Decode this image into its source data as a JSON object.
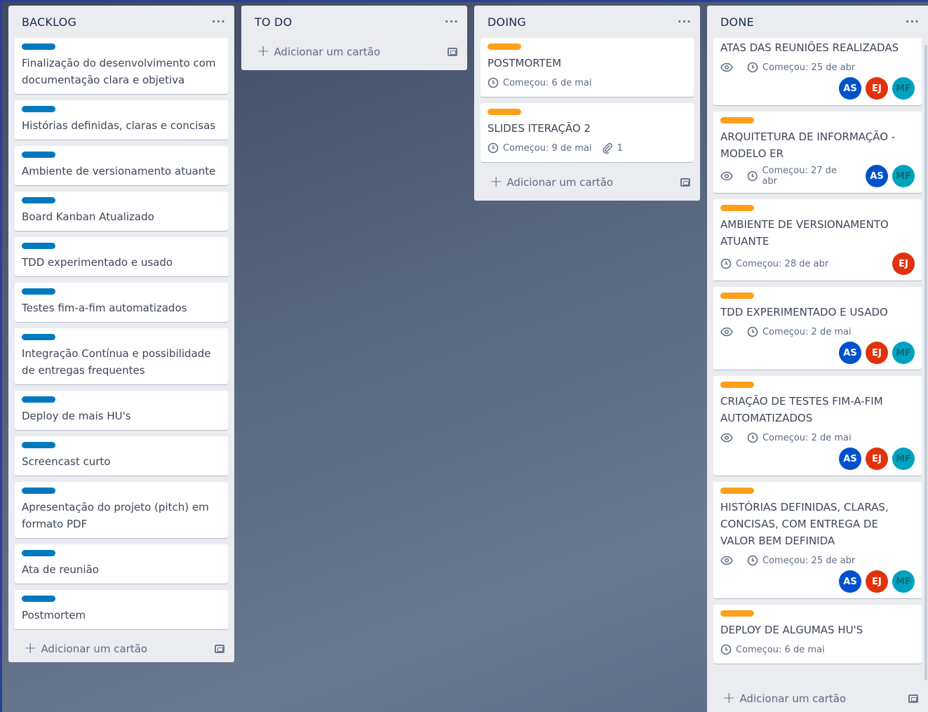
{
  "board": {
    "add_card_label": "Adicionar um cartão",
    "menu_label": "···",
    "colors": {
      "blue_label": "#0079bf",
      "orange_label": "#ff9f1a",
      "avatar_as": "#0052cc",
      "avatar_ej": "#e0320d",
      "avatar_mf": "#00a3bf"
    }
  },
  "lists": {
    "backlog": {
      "title": "BACKLOG",
      "cards": [
        {
          "title": "Finalização do desenvolvimento com documentação clara e objetiva"
        },
        {
          "title": "Histórias definidas, claras e concisas"
        },
        {
          "title": "Ambiente de versionamento atuante"
        },
        {
          "title": "Board Kanban Atualizado"
        },
        {
          "title": "TDD experimentado e usado"
        },
        {
          "title": "Testes fim-a-fim automatizados"
        },
        {
          "title": "Integração Contínua e possibilidade de entregas frequentes"
        },
        {
          "title": "Deploy de mais HU's"
        },
        {
          "title": "Screencast curto"
        },
        {
          "title": "Apresentação do projeto (pitch) em formato PDF"
        },
        {
          "title": "Ata de reunião"
        },
        {
          "title": "Postmortem"
        }
      ]
    },
    "todo": {
      "title": "TO DO"
    },
    "doing": {
      "title": "DOING",
      "cards": [
        {
          "title": "POSTMORTEM",
          "start": "Começou: 6 de mai"
        },
        {
          "title": "SLIDES ITERAÇÃO 2",
          "start": "Começou: 9 de mai",
          "attachments": "1"
        }
      ]
    },
    "done": {
      "title": "DONE",
      "cards": [
        {
          "title": "ATAS DAS REUNIÕES REALIZADAS",
          "start": "Começou: 25 de abr",
          "members": [
            "AS",
            "EJ",
            "MF"
          ]
        },
        {
          "title": "ARQUITETURA DE INFORMAÇÃO - MODELO ER",
          "start": "Começou: 27 de abr",
          "members": [
            "AS",
            "MF"
          ]
        },
        {
          "title": "AMBIENTE DE VERSIONAMENTO ATUANTE",
          "start": "Começou: 28 de abr",
          "members": [
            "EJ"
          ]
        },
        {
          "title": "TDD EXPERIMENTADO E USADO",
          "start": "Começou: 2 de mai",
          "members": [
            "AS",
            "EJ",
            "MF"
          ]
        },
        {
          "title": "CRIAÇÃO DE TESTES FIM-A-FIM AUTOMATIZADOS",
          "start": "Começou: 2 de mai",
          "members": [
            "AS",
            "EJ",
            "MF"
          ]
        },
        {
          "title": "HISTÓRIAS DEFINIDAS, CLARAS, CONCISAS, COM ENTREGA DE VALOR BEM DEFINIDA",
          "start": "Começou: 25 de abr",
          "members": [
            "AS",
            "EJ",
            "MF"
          ]
        },
        {
          "title": "DEPLOY DE ALGUMAS HU'S",
          "start": "Começou: 6 de mai"
        }
      ]
    }
  }
}
